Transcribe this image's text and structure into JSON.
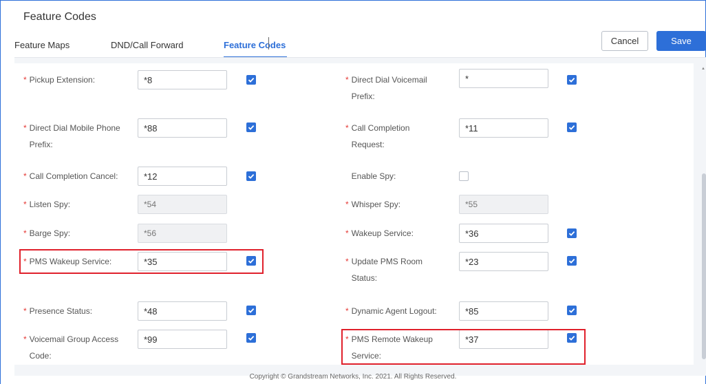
{
  "page": {
    "title": "Feature Codes"
  },
  "tabs": [
    {
      "label": "Feature Maps"
    },
    {
      "label": "DND/Call Forward"
    },
    {
      "label": "Feature Codes"
    }
  ],
  "actions": {
    "cancel_label": "Cancel",
    "save_label": "Save"
  },
  "fields": {
    "pickup_extension": {
      "label": "Pickup Extension:",
      "value": "*8",
      "enabled": true
    },
    "direct_dial_voicemail_prefix": {
      "label_line1": "Direct Dial Voicemail",
      "label_line2": "Prefix:",
      "value": "*",
      "enabled": true
    },
    "direct_dial_mobile_phone_prefix": {
      "label_line1": "Direct Dial Mobile Phone",
      "label_line2": "Prefix:",
      "value": "*88",
      "enabled": true
    },
    "call_completion_request": {
      "label_line1": "Call Completion",
      "label_line2": "Request:",
      "value": "*11",
      "enabled": true
    },
    "call_completion_cancel": {
      "label": "Call Completion Cancel:",
      "value": "*12",
      "enabled": true
    },
    "enable_spy": {
      "label": "Enable Spy:",
      "enabled": false
    },
    "listen_spy": {
      "label": "Listen Spy:",
      "placeholder": "*54"
    },
    "whisper_spy": {
      "label": "Whisper Spy:",
      "placeholder": "*55"
    },
    "barge_spy": {
      "label": "Barge Spy:",
      "placeholder": "*56"
    },
    "wakeup_service": {
      "label": "Wakeup Service:",
      "value": "*36",
      "enabled": true
    },
    "pms_wakeup_service": {
      "label": "PMS Wakeup Service:",
      "value": "*35",
      "enabled": true
    },
    "update_pms_room_status": {
      "label_line1": "Update PMS Room",
      "label_line2": "Status:",
      "value": "*23",
      "enabled": true
    },
    "presence_status": {
      "label": "Presence Status:",
      "value": "*48",
      "enabled": true
    },
    "dynamic_agent_logout": {
      "label": "Dynamic Agent Logout:",
      "value": "*85",
      "enabled": true
    },
    "voicemail_group_access_code": {
      "label_line1": "Voicemail Group Access",
      "label_line2": "Code:",
      "value": "*99",
      "enabled": true
    },
    "pms_remote_wakeup_service": {
      "label_line1": "PMS Remote Wakeup",
      "label_line2": "Service:",
      "value": "*37",
      "enabled": true
    }
  },
  "footer": {
    "text": "Copyright © Grandstream Networks, Inc. 2021. All Rights Reserved."
  },
  "colors": {
    "accent": "#2d6fd8",
    "required": "#e53935",
    "highlight": "#e0202b"
  },
  "icons": {
    "checkbox_checked": "check-icon"
  }
}
